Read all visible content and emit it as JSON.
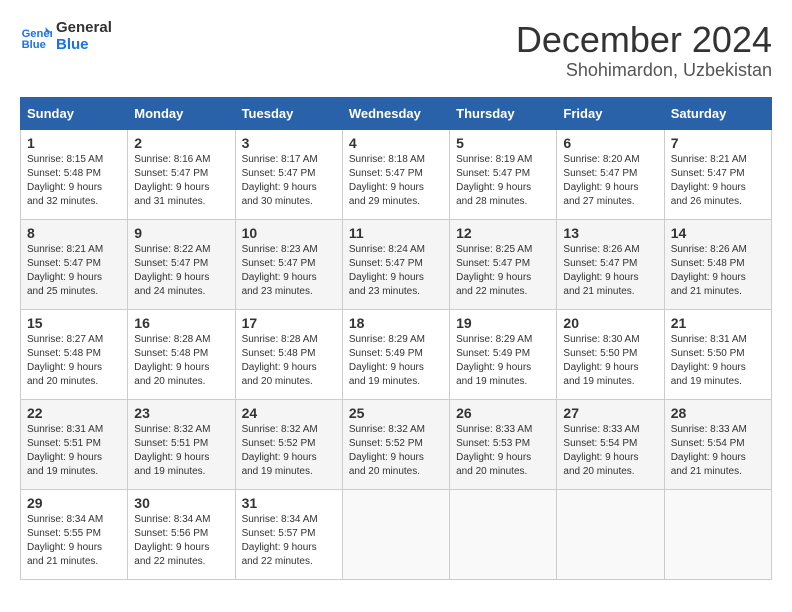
{
  "header": {
    "logo_line1": "General",
    "logo_line2": "Blue",
    "month": "December 2024",
    "location": "Shohimardon, Uzbekistan"
  },
  "weekdays": [
    "Sunday",
    "Monday",
    "Tuesday",
    "Wednesday",
    "Thursday",
    "Friday",
    "Saturday"
  ],
  "weeks": [
    [
      {
        "day": 1,
        "sunrise": "8:15 AM",
        "sunset": "5:48 PM",
        "daylight": "9 hours and 32 minutes."
      },
      {
        "day": 2,
        "sunrise": "8:16 AM",
        "sunset": "5:47 PM",
        "daylight": "9 hours and 31 minutes."
      },
      {
        "day": 3,
        "sunrise": "8:17 AM",
        "sunset": "5:47 PM",
        "daylight": "9 hours and 30 minutes."
      },
      {
        "day": 4,
        "sunrise": "8:18 AM",
        "sunset": "5:47 PM",
        "daylight": "9 hours and 29 minutes."
      },
      {
        "day": 5,
        "sunrise": "8:19 AM",
        "sunset": "5:47 PM",
        "daylight": "9 hours and 28 minutes."
      },
      {
        "day": 6,
        "sunrise": "8:20 AM",
        "sunset": "5:47 PM",
        "daylight": "9 hours and 27 minutes."
      },
      {
        "day": 7,
        "sunrise": "8:21 AM",
        "sunset": "5:47 PM",
        "daylight": "9 hours and 26 minutes."
      }
    ],
    [
      {
        "day": 8,
        "sunrise": "8:21 AM",
        "sunset": "5:47 PM",
        "daylight": "9 hours and 25 minutes."
      },
      {
        "day": 9,
        "sunrise": "8:22 AM",
        "sunset": "5:47 PM",
        "daylight": "9 hours and 24 minutes."
      },
      {
        "day": 10,
        "sunrise": "8:23 AM",
        "sunset": "5:47 PM",
        "daylight": "9 hours and 23 minutes."
      },
      {
        "day": 11,
        "sunrise": "8:24 AM",
        "sunset": "5:47 PM",
        "daylight": "9 hours and 23 minutes."
      },
      {
        "day": 12,
        "sunrise": "8:25 AM",
        "sunset": "5:47 PM",
        "daylight": "9 hours and 22 minutes."
      },
      {
        "day": 13,
        "sunrise": "8:26 AM",
        "sunset": "5:47 PM",
        "daylight": "9 hours and 21 minutes."
      },
      {
        "day": 14,
        "sunrise": "8:26 AM",
        "sunset": "5:48 PM",
        "daylight": "9 hours and 21 minutes."
      }
    ],
    [
      {
        "day": 15,
        "sunrise": "8:27 AM",
        "sunset": "5:48 PM",
        "daylight": "9 hours and 20 minutes."
      },
      {
        "day": 16,
        "sunrise": "8:28 AM",
        "sunset": "5:48 PM",
        "daylight": "9 hours and 20 minutes."
      },
      {
        "day": 17,
        "sunrise": "8:28 AM",
        "sunset": "5:48 PM",
        "daylight": "9 hours and 20 minutes."
      },
      {
        "day": 18,
        "sunrise": "8:29 AM",
        "sunset": "5:49 PM",
        "daylight": "9 hours and 19 minutes."
      },
      {
        "day": 19,
        "sunrise": "8:29 AM",
        "sunset": "5:49 PM",
        "daylight": "9 hours and 19 minutes."
      },
      {
        "day": 20,
        "sunrise": "8:30 AM",
        "sunset": "5:50 PM",
        "daylight": "9 hours and 19 minutes."
      },
      {
        "day": 21,
        "sunrise": "8:31 AM",
        "sunset": "5:50 PM",
        "daylight": "9 hours and 19 minutes."
      }
    ],
    [
      {
        "day": 22,
        "sunrise": "8:31 AM",
        "sunset": "5:51 PM",
        "daylight": "9 hours and 19 minutes."
      },
      {
        "day": 23,
        "sunrise": "8:32 AM",
        "sunset": "5:51 PM",
        "daylight": "9 hours and 19 minutes."
      },
      {
        "day": 24,
        "sunrise": "8:32 AM",
        "sunset": "5:52 PM",
        "daylight": "9 hours and 19 minutes."
      },
      {
        "day": 25,
        "sunrise": "8:32 AM",
        "sunset": "5:52 PM",
        "daylight": "9 hours and 20 minutes."
      },
      {
        "day": 26,
        "sunrise": "8:33 AM",
        "sunset": "5:53 PM",
        "daylight": "9 hours and 20 minutes."
      },
      {
        "day": 27,
        "sunrise": "8:33 AM",
        "sunset": "5:54 PM",
        "daylight": "9 hours and 20 minutes."
      },
      {
        "day": 28,
        "sunrise": "8:33 AM",
        "sunset": "5:54 PM",
        "daylight": "9 hours and 21 minutes."
      }
    ],
    [
      {
        "day": 29,
        "sunrise": "8:34 AM",
        "sunset": "5:55 PM",
        "daylight": "9 hours and 21 minutes."
      },
      {
        "day": 30,
        "sunrise": "8:34 AM",
        "sunset": "5:56 PM",
        "daylight": "9 hours and 22 minutes."
      },
      {
        "day": 31,
        "sunrise": "8:34 AM",
        "sunset": "5:57 PM",
        "daylight": "9 hours and 22 minutes."
      },
      null,
      null,
      null,
      null
    ]
  ],
  "labels": {
    "sunrise": "Sunrise:",
    "sunset": "Sunset:",
    "daylight": "Daylight:"
  }
}
